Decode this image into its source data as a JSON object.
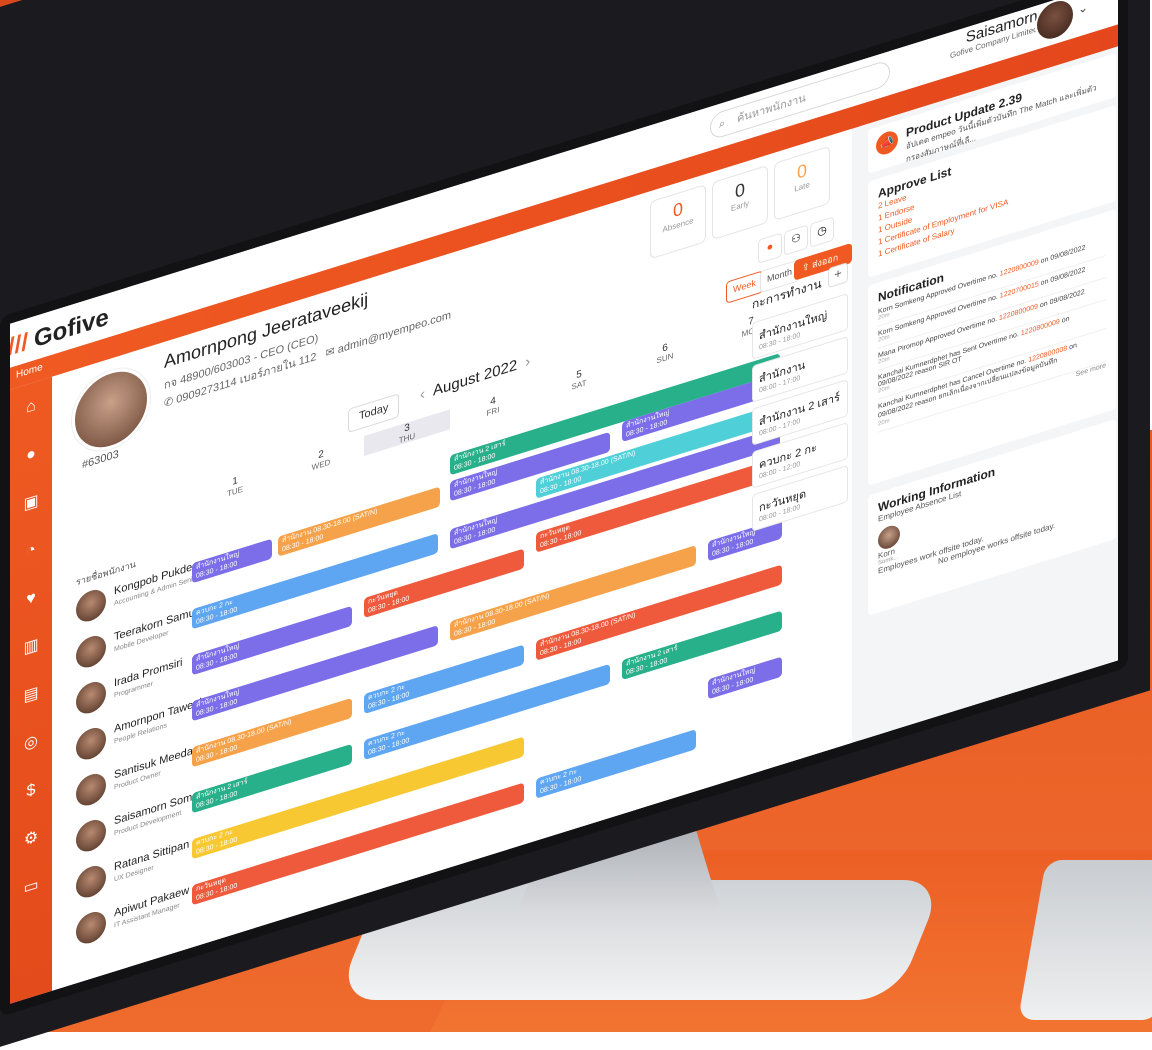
{
  "app": {
    "logo": "Gofive",
    "search_placeholder": "ค้นหาพนักงาน",
    "breadcrumb": "Home",
    "user": {
      "name": "Saisamorn",
      "company": "Gofive Company Limited"
    }
  },
  "employee": {
    "name": "Amornpong Jeerataveekij",
    "code_line": "กจ 48900/603003 - CEO (CEO)",
    "phone": "0909273114 เบอร์ภายใน 112",
    "email": "admin@myempeo.com",
    "id": "#63003"
  },
  "stats": [
    {
      "value": "0",
      "label": "Absence",
      "color": "#f05a22"
    },
    {
      "value": "0",
      "label": "Early",
      "color": "#333333"
    },
    {
      "value": "0",
      "label": "Late",
      "color": "#f6a24a"
    }
  ],
  "toolbar": {
    "week": "Week",
    "month": "Month",
    "export": "ส่งออกข้อมูล"
  },
  "calendar": {
    "today_label": "Today",
    "month": "August 2022",
    "row_title": "รายชื่อพนักงาน",
    "days": [
      {
        "num": "1",
        "dow": "TUE"
      },
      {
        "num": "2",
        "dow": "WED"
      },
      {
        "num": "3",
        "dow": "THU"
      },
      {
        "num": "4",
        "dow": "FRI"
      },
      {
        "num": "5",
        "dow": "SAT"
      },
      {
        "num": "6",
        "dow": "SUN"
      },
      {
        "num": "7",
        "dow": "MON"
      }
    ]
  },
  "people": [
    {
      "name": "Kongpob Pukdee",
      "role": "Accounting & Admin Senior Officer"
    },
    {
      "name": "Teerakorn Samuttara",
      "role": "Mobile Developer"
    },
    {
      "name": "Irada Promsiri",
      "role": "Programmer"
    },
    {
      "name": "Amornpon Taweekun",
      "role": "People Relations"
    },
    {
      "name": "Santisuk Meedam",
      "role": "Product Owner"
    },
    {
      "name": "Saisamorn Somngan",
      "role": "Product Development"
    },
    {
      "name": "Ratana Sittipan",
      "role": "UX Designer"
    },
    {
      "name": "Apiwut Pakaew",
      "role": "IT Assistant Manager"
    }
  ],
  "shifts_label": {
    "s1": "สำนักงานใหญ่",
    "s2": "สำนักงาน 2 เสาร์",
    "s3": "สำนักงาน 08.30-18.00 (SAT/N)",
    "s4": "ควบกะ 2 กะ",
    "s5": "กะวันหยุด",
    "time": "08:30 - 18:00"
  },
  "shift_types": {
    "title": "กะการทำงาน",
    "items": [
      {
        "name": "สำนักงานใหญ่",
        "time": "08:30 - 18:00"
      },
      {
        "name": "สำนักงาน",
        "time": "08:00 - 17:00"
      },
      {
        "name": "สำนักงาน 2 เสาร์",
        "time": "08:00 - 17:00"
      },
      {
        "name": "ควบกะ 2 กะ",
        "time": "08:00 - 12:00"
      },
      {
        "name": "กะวันหยุด",
        "time": "08:00 - 18:00"
      }
    ]
  },
  "product_update": {
    "title": "Product Update 2.39",
    "text": "อัปเดต empeo วันนี้เพิ่มตัวบันทึก The Match และเพิ่มตัวกรองสัมภาษณ์ที่เลื..."
  },
  "approve_list": {
    "title": "Approve List",
    "items": [
      "2 Leave",
      "1 Endorse",
      "1 Outside",
      "1 Certificate of Employment for VISA",
      "1 Certificate of Salary"
    ]
  },
  "notification": {
    "title": "Notification",
    "items": [
      {
        "text": "Korn Somkeng Approved Overtime no. ",
        "ref": "1220800009",
        "tail": " on 09/08/2022",
        "ts": "20m"
      },
      {
        "text": "Korn Somkeng Approved Overtime no. ",
        "ref": "1220700015",
        "tail": " on 09/08/2022",
        "ts": "20m"
      },
      {
        "text": "Mana Piromop Approved Overtime no. ",
        "ref": "1220800009",
        "tail": " on 09/08/2022",
        "ts": "20m"
      },
      {
        "text": "Kanchai Kumnerdphet has Sent Overtime no. ",
        "ref": "1220800009",
        "tail": " on 09/08/2022 reason SIR OT",
        "ts": "20m"
      },
      {
        "text": "Kanchai Kumnerdphet has Cancel Overtime no. ",
        "ref": "1220800008",
        "tail": " on 09/08/2022 reason ยกเลิกเนื่องจากเปลี่ยนแปลงข้อมูลบันทึก",
        "ts": "20m"
      }
    ],
    "see_more": "See more"
  },
  "working_info": {
    "title": "Working Information",
    "subtitle": "Employee Absence List",
    "person": "Korn",
    "person_sub": "Somk...",
    "offsite1": "Employees work offsite today.",
    "offsite2": "No employee works offsite today."
  }
}
